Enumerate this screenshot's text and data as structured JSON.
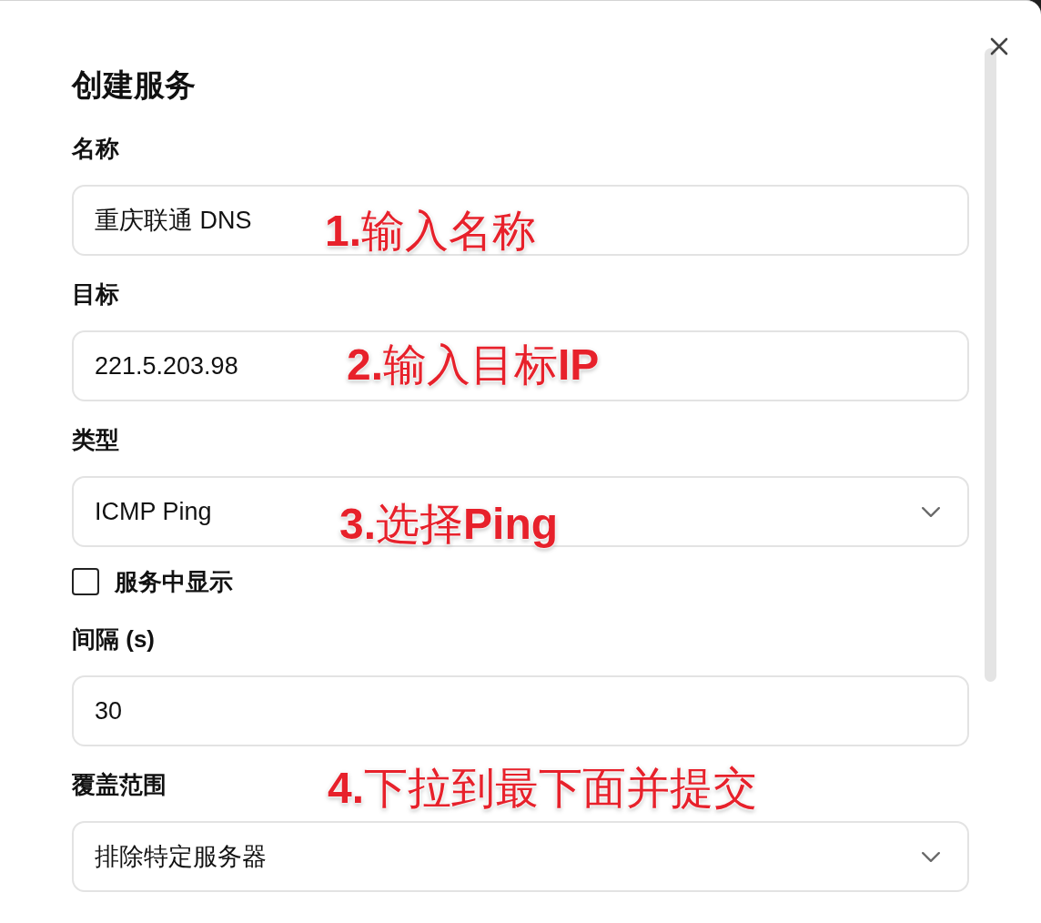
{
  "dialog": {
    "title": "创建服务",
    "fields": [
      {
        "kind": "text",
        "label": "名称",
        "value": "重庆联通 DNS",
        "annotation": "**1.**输入名称"
      },
      {
        "kind": "text",
        "label": "目标",
        "value": "221.5.203.98",
        "annotation": "**2.**输入目标**IP**"
      },
      {
        "kind": "select",
        "label": "类型",
        "value": "ICMP Ping",
        "annotation": "**3.**选择**Ping**"
      },
      {
        "kind": "checkbox",
        "label": "服务中显示",
        "checked": false
      },
      {
        "kind": "text",
        "label": "间隔 (s)",
        "value": "30"
      },
      {
        "kind": "select",
        "label": "覆盖范围",
        "value": "排除特定服务器",
        "annotation": "**4.**下拉到最下面并提交"
      }
    ]
  }
}
